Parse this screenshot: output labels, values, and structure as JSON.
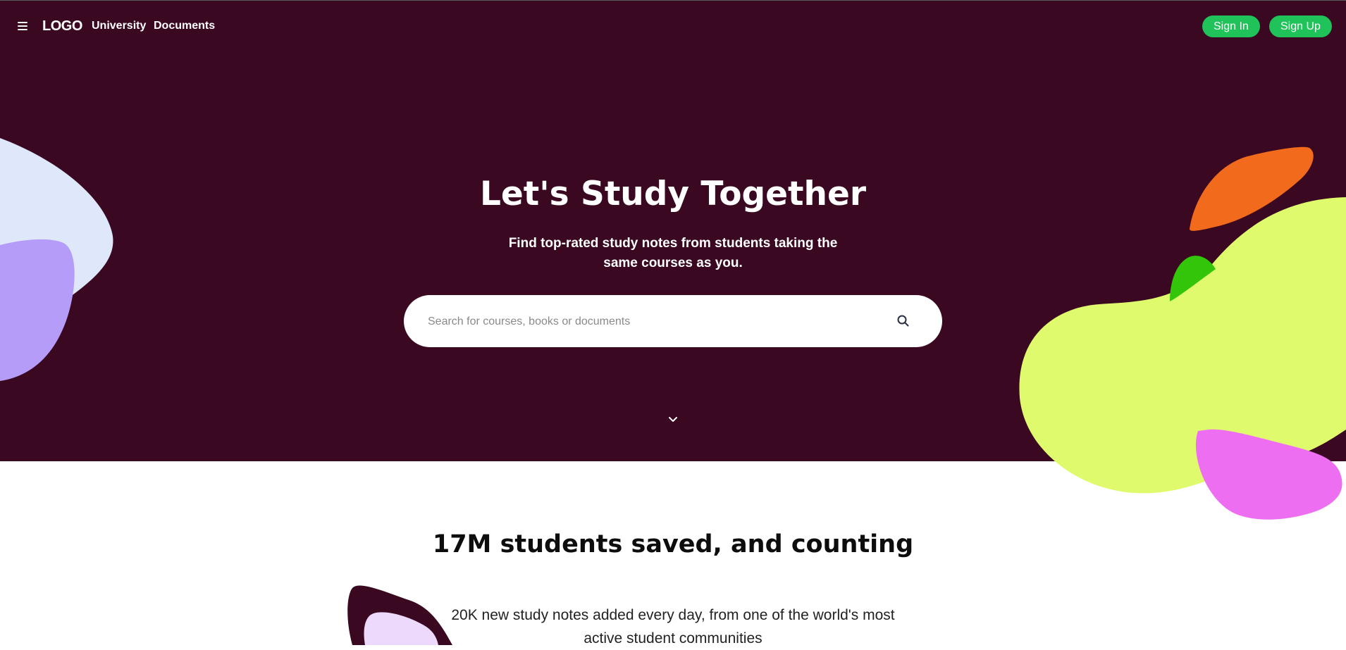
{
  "nav": {
    "logo": "LOGO",
    "links": [
      "University",
      "Documents"
    ],
    "sign_in": "Sign In",
    "sign_up": "Sign Up"
  },
  "hero": {
    "title": "Let's Study Together",
    "subtitle": "Find top-rated study notes from students taking the same courses as you.",
    "search_placeholder": "Search for courses, books or documents"
  },
  "stats": {
    "title": "17M students saved, and counting",
    "subtitle": "20K new study notes added every day, from one of the world's most active student communities"
  },
  "icons": {
    "menu": "hamburger-menu-icon",
    "search": "search-icon",
    "scroll": "chevron-down-icon"
  },
  "colors": {
    "hero_background": "#3a0820",
    "button_green": "#1fc35a",
    "blob_light_blue": "#dfe8fb",
    "blob_purple": "#b49cf8",
    "blob_orange": "#f26b1d",
    "blob_green": "#32c50a",
    "blob_lime": "#e0fa6e",
    "blob_magenta": "#ee6ef2",
    "blob_lilac": "#ecd9fb"
  }
}
